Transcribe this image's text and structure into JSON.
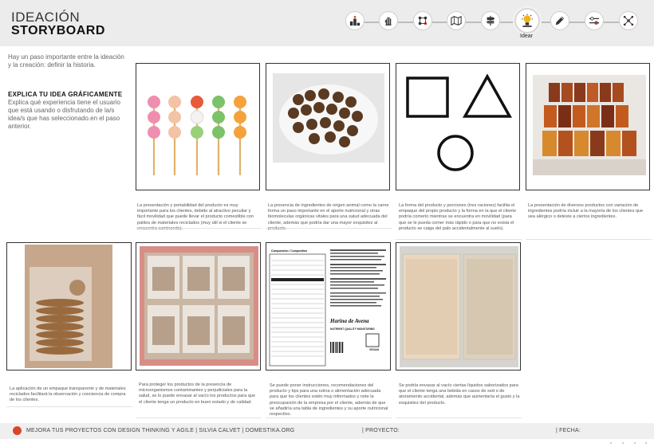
{
  "header": {
    "title_line1": "IDEACIÓN",
    "title_line2": "STORYBOARD",
    "active_step_label": "Idear",
    "steps": [
      {
        "icon": "podium-icon"
      },
      {
        "icon": "hand-icon"
      },
      {
        "icon": "network-icon"
      },
      {
        "icon": "map-icon"
      },
      {
        "icon": "signpost-icon"
      },
      {
        "icon": "target-icon"
      },
      {
        "icon": "lightbulb-icon",
        "active": true
      },
      {
        "icon": "pencil-icon"
      },
      {
        "icon": "gears-icon"
      },
      {
        "icon": "hub-icon"
      }
    ]
  },
  "intro": {
    "text": "Hay un paso importante entre la ideación y la creación: definir la historia.",
    "subtitle": "EXPLICA TU IDEA GRÁFICAMENTE",
    "subtext": "Explica qué experiencia tiene el usuario que está usando o disfrutando de la/s  idea/s que has seleccionado.en el paso anterior."
  },
  "row1": [
    {
      "caption": "La presentación y portabilidad del producto es muy importante para los clientes, debido al atractivo peculiar y fácil movilidad que puede llevar el producto comestible con palitos de materiales reciclados (muy útil si el cliente se encuentra caminando)."
    },
    {
      "caption": "La presencia de ingredientes de origen animal como la carne forma un paso importante en el aporte nutricional y otras biomoleculas orgánicas vitales para una salud adecuada del cliente, además que podría dar una mayor exquisitez al producto."
    },
    {
      "caption": "La forma del producto y porciones (tres raciones) facilita el empaque del propio producto y la forma en la que el cliente podría comerlo mientras se encuentra en movilidad (para que se le pueda comer más rápido o para que no exista el producto se caiga del palo accidentalmente al suelo)."
    },
    {
      "caption": "La presentación de diversos productos con variación de ingredientes podría incluir a la mayoría de los clientes que sea alérgico o deteste a ciertos ingredientes."
    }
  ],
  "row2": [
    {
      "caption": "La aplicación de un empaque transparente y de materiales reciclados facilitará la observación y conciencia de compra de los clientes."
    },
    {
      "caption": "Para proteger los productos de la presencia de microorganismos contaminantes y perjudiciales para la salud, se lo puede envasar al vacío los productos para que el cliente tenga un producto en buen estado y de calidad."
    },
    {
      "caption": "Se puede poner instrucciones, recomendaciones del producto y tips para una rutina o alimentación adecuada  para que los clientes estén muy informados y note la preocupación de la empresa por el cliente, además de que se añadiría una tabla de ingredientes y su aporte nutricional respectivo."
    },
    {
      "caption": "Se podría envasar al vacío ciertas líquidos saborizados para que el cliente tenga una bebida en casos de sed o de atoramiento accidental, además que aumentaría el gusto y la exquisitez del producto."
    }
  ],
  "nutrition": {
    "heading": "Composición / Composition",
    "brand": "Harina de Avena",
    "subbrand": "NUTRIENT QUALITY MONITORING",
    "code": "VEGAN"
  },
  "footer": {
    "slogan": "MEJORA TUS PROYECTOS CON DESIGN THINKING Y AGILE",
    "author": "SILVIA CALVET",
    "site": "DOMESTIKA.ORG",
    "project_label": "| PROYECTO:",
    "date_label": "| FECHA:"
  },
  "colors": {
    "header_bg": "#ececec",
    "footer_accent": "#d9472b",
    "frame_border": "#333333"
  }
}
